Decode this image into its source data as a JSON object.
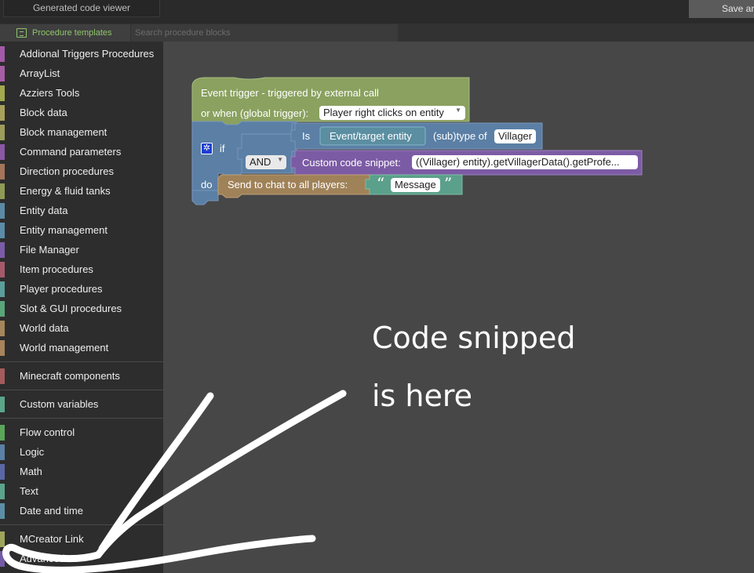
{
  "topbar": {
    "code_viewer_tab": "Generated code viewer",
    "save_button": "Save an"
  },
  "palette": {
    "templates_tab": "Procedure templates",
    "search_placeholder": "Search procedure blocks"
  },
  "sidebar": {
    "group1": [
      {
        "label": "Addional Triggers Procedures",
        "color": "#a35aa8"
      },
      {
        "label": "ArrayList",
        "color": "#a75ea5"
      },
      {
        "label": "Azziers Tools",
        "color": "#a2a94e"
      },
      {
        "label": "Block data",
        "color": "#a8a15c"
      },
      {
        "label": "Block management",
        "color": "#9c9c5c"
      },
      {
        "label": "Command parameters",
        "color": "#8b58a5"
      },
      {
        "label": "Direction procedures",
        "color": "#a5745c"
      },
      {
        "label": "Energy & fluid tanks",
        "color": "#8f9a55"
      },
      {
        "label": "Entity data",
        "color": "#5c8aa5"
      },
      {
        "label": "Entity management",
        "color": "#5b8ba8"
      },
      {
        "label": "File Manager",
        "color": "#7b5ca8"
      },
      {
        "label": "Item procedures",
        "color": "#a55a6b"
      },
      {
        "label": "Player procedures",
        "color": "#5b9e9a"
      },
      {
        "label": "Slot & GUI procedures",
        "color": "#5aa57a"
      },
      {
        "label": "World data",
        "color": "#a5865c"
      },
      {
        "label": "World management",
        "color": "#a8835c"
      }
    ],
    "group2": [
      {
        "label": "Minecraft components",
        "color": "#a55b5b"
      }
    ],
    "group3": [
      {
        "label": "Custom variables",
        "color": "#5ba58a"
      }
    ],
    "group4": [
      {
        "label": "Flow control",
        "color": "#5ba55b"
      },
      {
        "label": "Logic",
        "color": "#5b80a5"
      },
      {
        "label": "Math",
        "color": "#5b67a5"
      },
      {
        "label": "Text",
        "color": "#5ba58c"
      },
      {
        "label": "Date and time",
        "color": "#5b8ea5"
      }
    ],
    "group5": [
      {
        "label": "MCreator Link",
        "color": "#9ea55b"
      },
      {
        "label": "Advanced",
        "color": "#745ba5"
      }
    ]
  },
  "blocks": {
    "trigger_title": "Event trigger - triggered by external call",
    "trigger_when": "or when (global trigger):",
    "trigger_value": "Player right clicks on entity",
    "if_label": "if",
    "do_label": "do",
    "is_label": "Is",
    "entity_field": "Event/target entity",
    "subtype_label": "(sub)type of",
    "subtype_value": "Villager",
    "and_label": "AND",
    "snippet_label": "Custom code snippet:",
    "snippet_value": "((Villager) entity).getVillagerData().getProfe...",
    "chat_label": "Send to chat to all players:",
    "message_value": "Message",
    "open_quote": "“",
    "close_quote": "”",
    "colors": {
      "event": "#8aa15f",
      "logic": "#5b7fa5",
      "entity": "#5b8ea1",
      "snippet": "#7c5ba5",
      "chat": "#a08259",
      "text": "#5ba08a"
    }
  },
  "annotation": {
    "line1": "Code snipped",
    "line2": "is here"
  }
}
